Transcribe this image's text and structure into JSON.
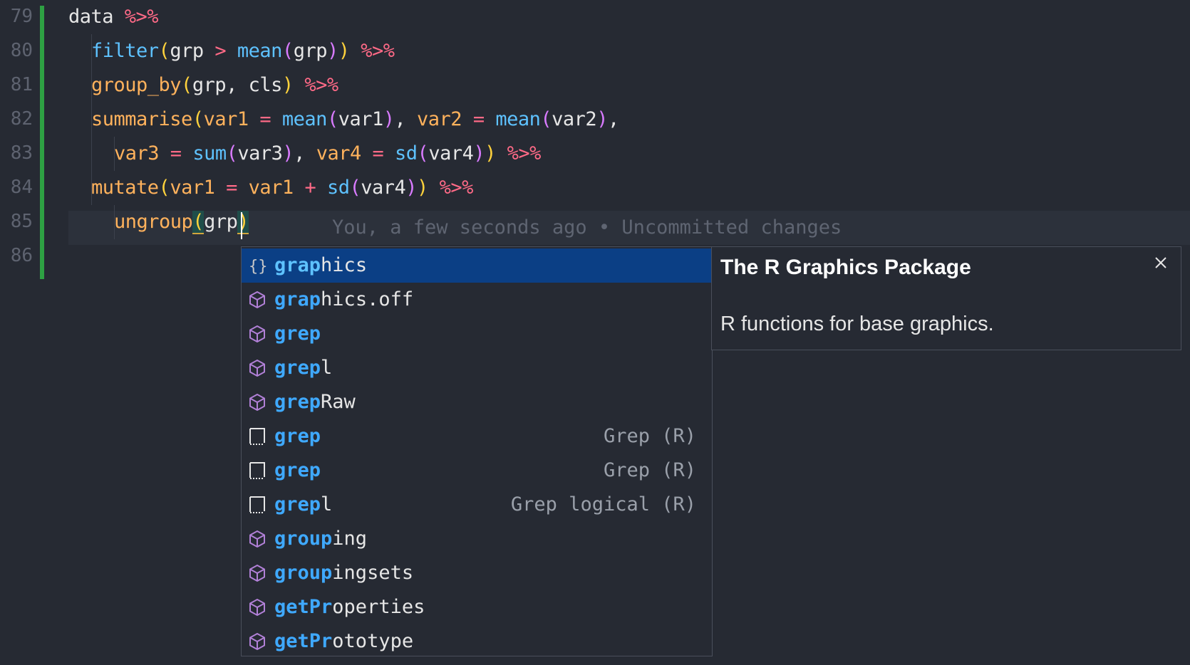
{
  "editor": {
    "line_numbers": [
      "79",
      "80",
      "81",
      "82",
      "83",
      "84",
      "85",
      "86"
    ],
    "blame": "You, a few seconds ago • Uncommitted changes",
    "colors": {
      "background": "#262a33",
      "git_added": "#2ea043",
      "selection": "#0b3f85",
      "match": "#3fa9ff"
    }
  },
  "suggest": {
    "items": [
      {
        "icon": "braces-icon",
        "match": "gra",
        "mid": "p",
        "rest": "hics",
        "detail": "",
        "selected": true
      },
      {
        "icon": "cube-icon",
        "match": "gra",
        "mid": "p",
        "rest": "hics.off",
        "detail": ""
      },
      {
        "icon": "cube-icon",
        "match": "gre",
        "mid": "p",
        "rest": "",
        "detail": ""
      },
      {
        "icon": "cube-icon",
        "match": "gre",
        "mid": "p",
        "rest": "l",
        "detail": ""
      },
      {
        "icon": "cube-icon",
        "match": "gre",
        "mid": "p",
        "rest": "Raw",
        "detail": ""
      },
      {
        "icon": "snippet-icon",
        "match": "gre",
        "mid": "p",
        "rest": "",
        "detail": "Grep (R)"
      },
      {
        "icon": "snippet-icon",
        "match": "gre",
        "mid": "p",
        "rest": "",
        "detail": "Grep (R)"
      },
      {
        "icon": "snippet-icon",
        "match": "gre",
        "mid": "p",
        "rest": "l",
        "detail": "Grep logical (R)"
      },
      {
        "icon": "cube-icon",
        "match": "grou",
        "mid": "p",
        "rest": "ing",
        "detail": ""
      },
      {
        "icon": "cube-icon",
        "match": "grou",
        "mid": "p",
        "rest": "ingsets",
        "detail": ""
      },
      {
        "icon": "cube-icon",
        "match": "getP",
        "mid": "r",
        "rest": "operties",
        "detail": ""
      },
      {
        "icon": "cube-icon",
        "match": "getP",
        "mid": "r",
        "rest": "ototype",
        "detail": ""
      }
    ]
  },
  "docs": {
    "title": "The R Graphics Package",
    "body": "R functions for base graphics.",
    "close_icon": "close-icon"
  }
}
